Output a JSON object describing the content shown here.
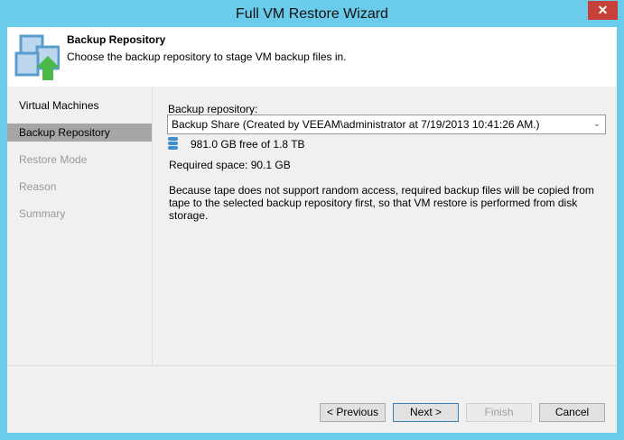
{
  "window": {
    "title": "Full VM Restore Wizard",
    "close_label": "✕"
  },
  "header": {
    "title": "Backup Repository",
    "subtitle": "Choose the backup repository to stage VM backup files in."
  },
  "steps": [
    {
      "label": "Virtual Machines",
      "state": "done"
    },
    {
      "label": "Backup Repository",
      "state": "active"
    },
    {
      "label": "Restore Mode",
      "state": "pending"
    },
    {
      "label": "Reason",
      "state": "pending"
    },
    {
      "label": "Summary",
      "state": "pending"
    }
  ],
  "main": {
    "repo_label": "Backup repository:",
    "repo_value": "Backup Share (Created by VEEAM\\administrator at 7/19/2013 10:41:26 AM.)",
    "free_space": "981.0 GB free of 1.8 TB",
    "required_space": "Required space:  90.1 GB",
    "note": "Because tape does not support random access, required backup files will be copied from tape to the selected backup repository first, so that VM restore is performed from disk storage."
  },
  "buttons": {
    "previous": "< Previous",
    "next": "Next >",
    "finish": "Finish",
    "cancel": "Cancel"
  }
}
